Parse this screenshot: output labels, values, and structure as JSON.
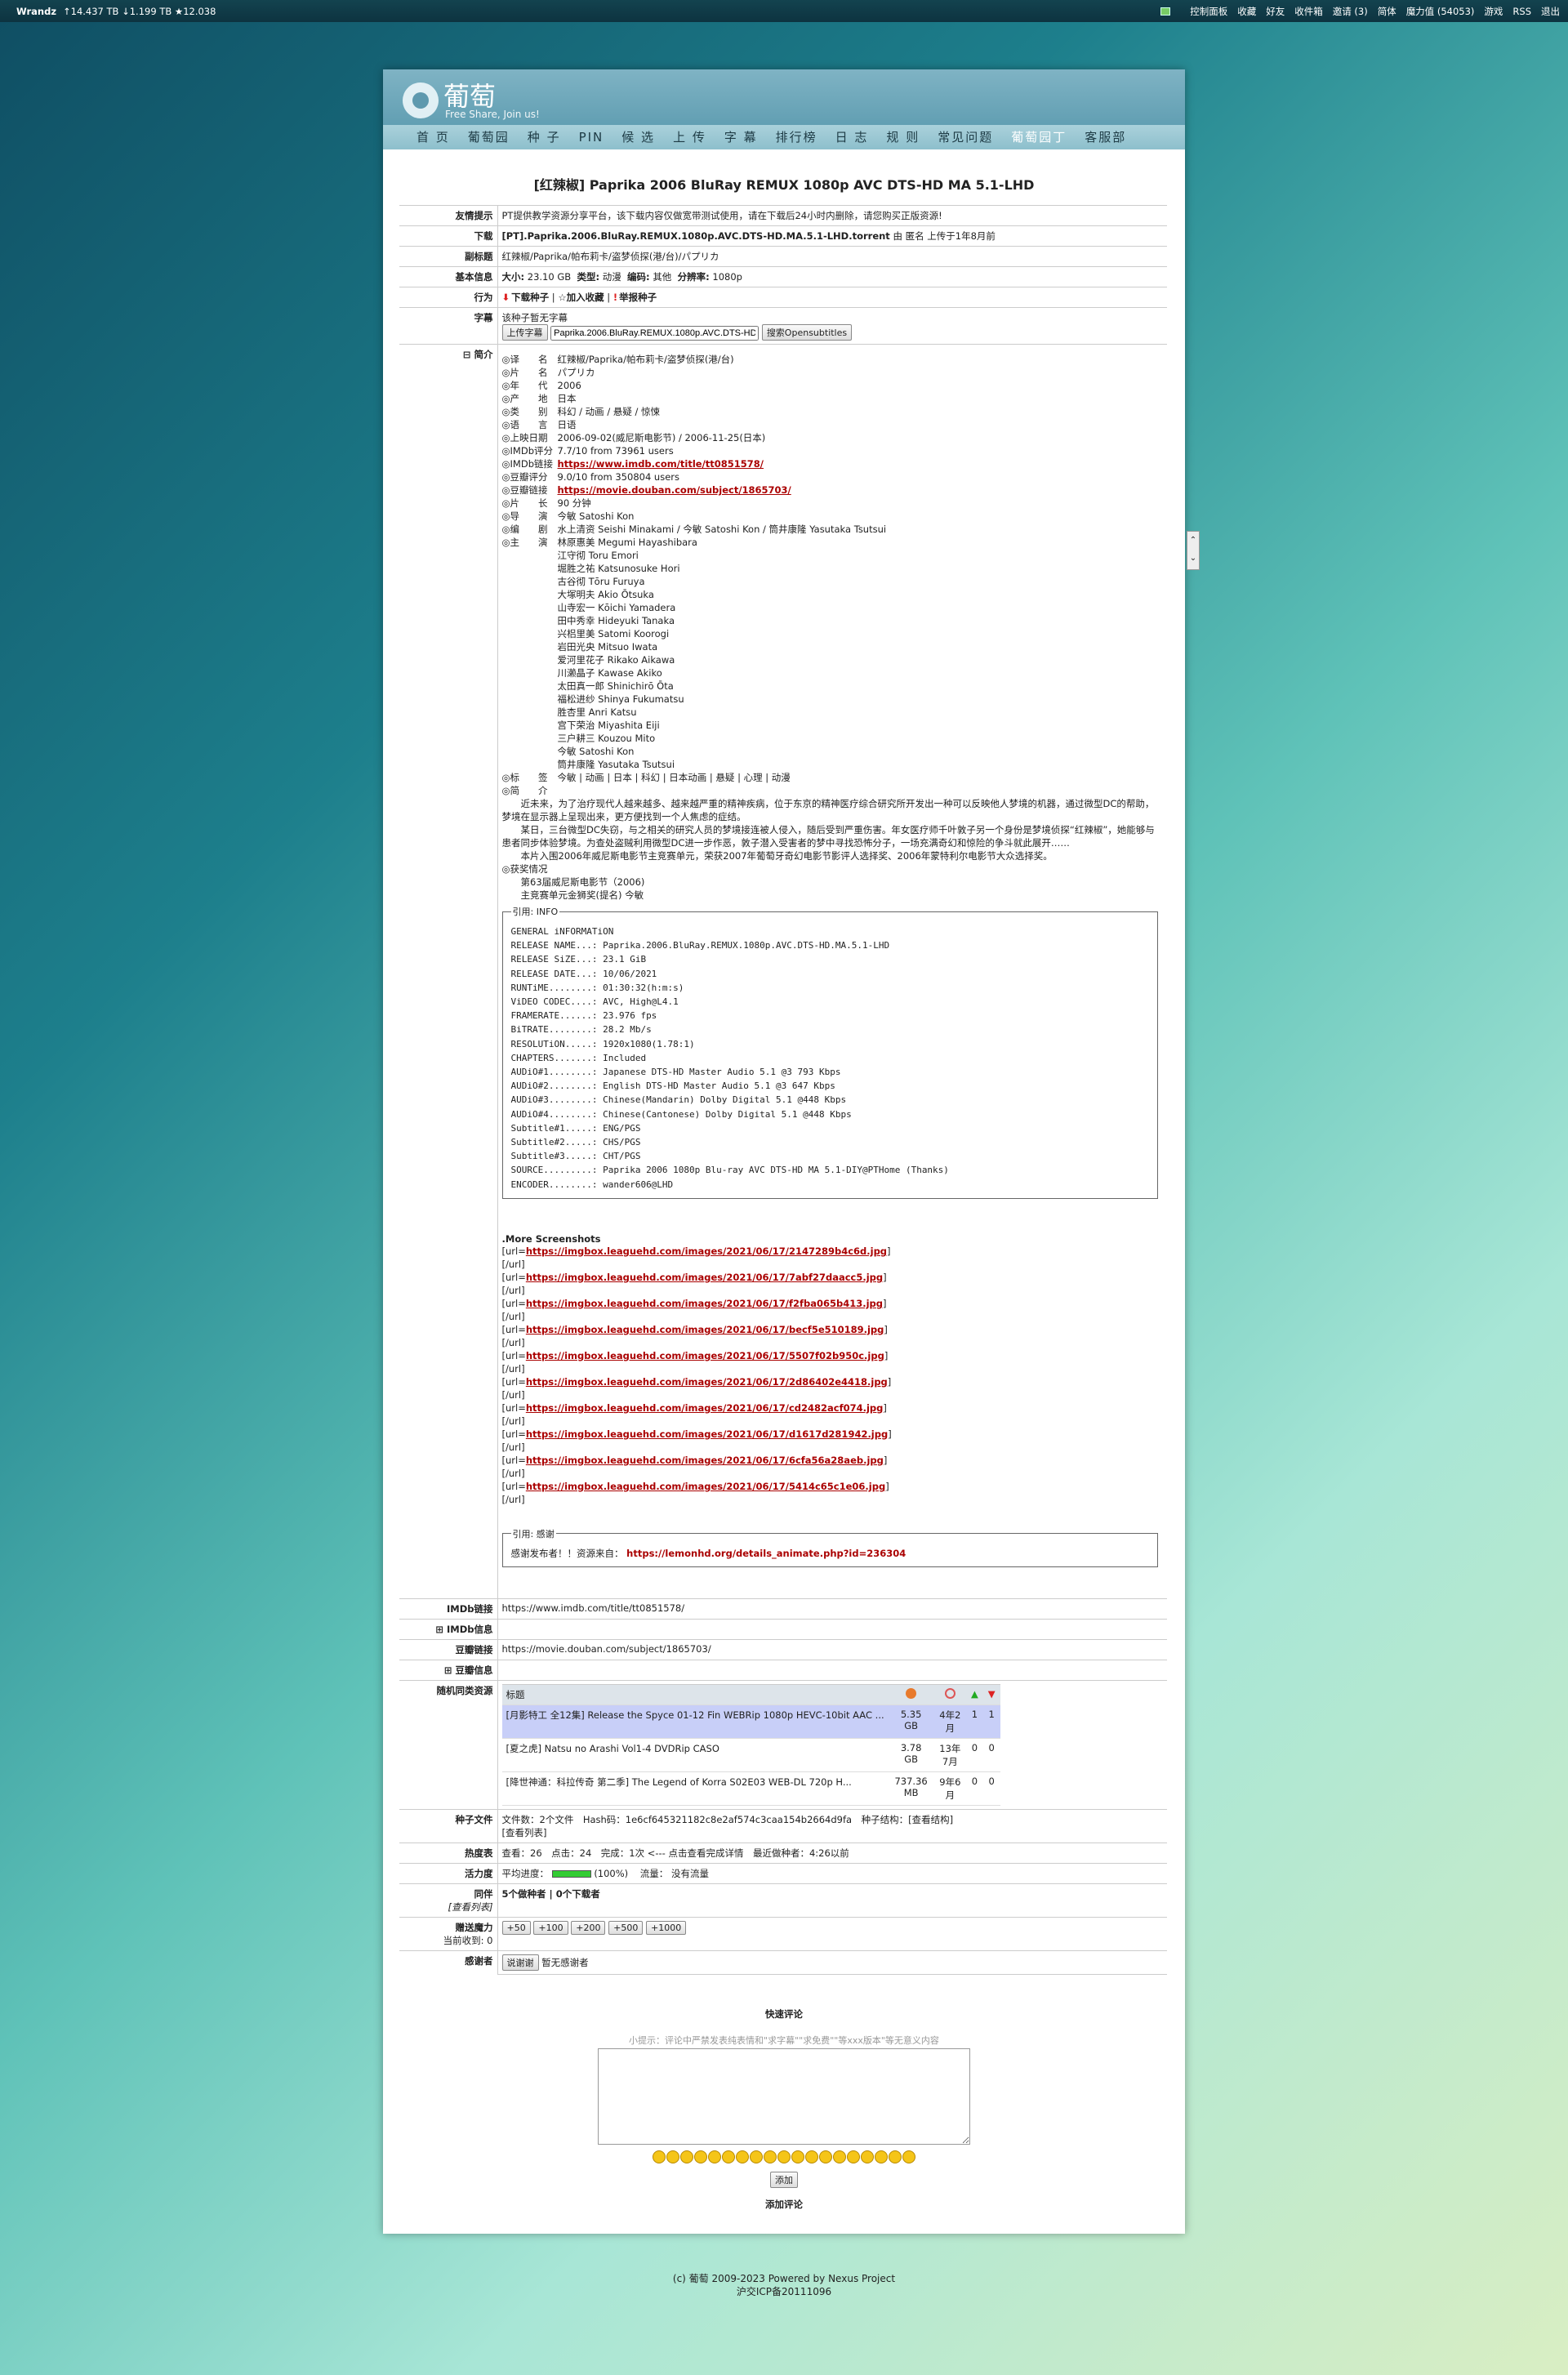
{
  "topbar": {
    "brand": "Wrandz",
    "stats": "↑14.437 TB ↓1.199 TB ★12.038",
    "links": [
      "控制面板",
      "收藏",
      "好友",
      "收件箱",
      "邀请 (3)",
      "简体",
      "魔力值 (54053)",
      "游戏",
      "RSS",
      "退出"
    ]
  },
  "site": {
    "name": "葡萄",
    "slogan": "Free Share, Join us!"
  },
  "nav": [
    "首 页",
    "葡萄园",
    "种 子",
    "PIN",
    "候 选",
    "上 传",
    "字 幕",
    "排行榜",
    "日 志",
    "规 则",
    "常见问题",
    "葡萄园丁",
    "客服部"
  ],
  "page_title": "[红辣椒] Paprika 2006 BluRay REMUX 1080p AVC DTS-HD MA 5.1-LHD",
  "rows": {
    "notice": {
      "label": "友情提示",
      "value": "PT提供教学资源分享平台，该下载内容仅做宽带测试使用，请在下载后24小时内删除，请您购买正版资源!"
    },
    "download": {
      "label": "下载",
      "file": "[PT].Paprika.2006.BluRay.REMUX.1080p.AVC.DTS-HD.MA.5.1-LHD.torrent",
      "by": "由 匿名 上传于1年8月前"
    },
    "subtitle": {
      "label": "副标题",
      "value": "红辣椒/Paprika/帕布莉卡/盗梦侦探(港/台)/パプリカ"
    },
    "basic": {
      "label": "基本信息",
      "size_label": "大小:",
      "size": "23.10 GB",
      "type_label": "类型:",
      "type": "动漫",
      "codec_label": "编码:",
      "codec": "其他",
      "res_label": "分辨率:",
      "res": "1080p"
    },
    "action": {
      "label": "行为",
      "download": "下载种子",
      "bookmark": "加入收藏",
      "report": "举报种子"
    },
    "subs": {
      "label": "字幕",
      "none": "该种子暂无字幕",
      "upload_btn": "上传字幕",
      "search_value": "Paprika.2006.BluRay.REMUX.1080p.AVC.DTS-HD",
      "search_btn": "搜索Opensubtitles"
    },
    "intro": {
      "label": "简介"
    }
  },
  "desc": [
    {
      "k": "◎译　　名",
      "v": "红辣椒/Paprika/帕布莉卡/盗梦侦探(港/台)"
    },
    {
      "k": "◎片　　名",
      "v": "パプリカ"
    },
    {
      "k": "◎年　　代",
      "v": "2006"
    },
    {
      "k": "◎产　　地",
      "v": "日本"
    },
    {
      "k": "◎类　　别",
      "v": "科幻 / 动画 / 悬疑 / 惊悚"
    },
    {
      "k": "◎语　　言",
      "v": "日语"
    },
    {
      "k": "◎上映日期",
      "v": "2006-09-02(威尼斯电影节) / 2006-11-25(日本)"
    },
    {
      "k": "◎IMDb评分",
      "v": "7.7/10 from 73961 users"
    },
    {
      "k": "◎IMDb链接",
      "v": "https://www.imdb.com/title/tt0851578/",
      "link": true
    },
    {
      "k": "◎豆瓣评分",
      "v": "9.0/10 from 350804 users"
    },
    {
      "k": "◎豆瓣链接",
      "v": "https://movie.douban.com/subject/1865703/",
      "link": true
    },
    {
      "k": "◎片　　长",
      "v": "90 分钟"
    },
    {
      "k": "◎导　　演",
      "v": "今敏 Satoshi Kon"
    },
    {
      "k": "◎编　　剧",
      "v": "水上清资 Seishi Minakami / 今敏 Satoshi Kon / 筒井康隆 Yasutaka Tsutsui"
    },
    {
      "k": "◎主　　演",
      "v": "林原惠美 Megumi Hayashibara"
    }
  ],
  "cast": [
    "江守彻 Toru Emori",
    "堀胜之祐 Katsunosuke Hori",
    "古谷彻 Tōru Furuya",
    "大塚明夫 Akio Ōtsuka",
    "山寺宏一 Kōichi Yamadera",
    "田中秀幸 Hideyuki Tanaka",
    "兴梠里美 Satomi Koorogi",
    "岩田光央 Mitsuo Iwata",
    "爱河里花子 Rikako Aikawa",
    "川濑晶子 Kawase Akiko",
    "太田真一郎 Shinichirō Ōta",
    "福松进纱 Shinya Fukumatsu",
    "胜杏里 Anri Katsu",
    "宫下荣治 Miyashita Eiji",
    "三户耕三 Kouzou Mito",
    "今敏 Satoshi Kon",
    "筒井康隆 Yasutaka Tsutsui"
  ],
  "desc2": [
    {
      "k": "◎标　　签",
      "v": "今敏 | 动画 | 日本 | 科幻 | 日本动画 | 悬疑 | 心理 | 动漫"
    },
    {
      "k": "◎简　　介",
      "v": ""
    }
  ],
  "synopsis": [
    "　　近未来，为了治疗现代人越来越多、越来越严重的精神疾病，位于东京的精神医疗综合研究所开发出一种可以反映他人梦境的机器，通过微型DC的帮助，梦境在显示器上呈现出来，更方便找到一个人焦虑的症结。",
    "　　某日，三台微型DC失窃，与之相关的研究人员的梦境接连被人侵入，随后受到严重伤害。年女医疗师千叶敦子另一个身份是梦境侦探“红辣椒”，她能够与患者同步体验梦境。为查处盗贼利用微型DC进一步作恶，敦子潜入受害者的梦中寻找恐怖分子，一场充满奇幻和惊险的争斗就此展开……",
    "　　本片入围2006年威尼斯电影节主竞赛单元，荣获2007年葡萄牙奇幻电影节影评人选择奖、2006年蒙特利尔电影节大众选择奖。"
  ],
  "awards": {
    "k": "◎获奖情况",
    "lines": [
      "　　第63届威尼斯电影节（2006)",
      "　　主竞赛单元金狮奖(提名) 今敏"
    ]
  },
  "info_legend": "引用: INFO",
  "info_text": "GENERAL iNFORMATiON\nRELEASE NAME...: Paprika.2006.BluRay.REMUX.1080p.AVC.DTS-HD.MA.5.1-LHD\nRELEASE SiZE...: 23.1 GiB\nRELEASE DATE...: 10/06/2021\nRUNTiME........: 01:30:32(h:m:s)\nViDEO CODEC....: AVC, High@L4.1\nFRAMERATE......: 23.976 fps\nBiTRATE........: 28.2 Mb/s\nRESOLUTiON.....: 1920x1080(1.78:1)\nCHAPTERS.......: Included\nAUDiO#1........: Japanese DTS-HD Master Audio 5.1 @3 793 Kbps\nAUDiO#2........: English DTS-HD Master Audio 5.1 @3 647 Kbps\nAUDiO#3........: Chinese(Mandarin) Dolby Digital 5.1 @448 Kbps\nAUDiO#4........: Chinese(Cantonese) Dolby Digital 5.1 @448 Kbps\nSubtitle#1.....: ENG/PGS\nSubtitle#2.....: CHS/PGS\nSubtitle#3.....: CHT/PGS\nSOURCE.........: Paprika 2006 1080p Blu-ray AVC DTS-HD MA 5.1-DIY@PTHome (Thanks)\nENCODER........: wander606@LHD",
  "screens_title": ".More Screenshots",
  "screens": [
    "https://imgbox.leaguehd.com/images/2021/06/17/2147289b4c6d.jpg",
    "https://imgbox.leaguehd.com/images/2021/06/17/7abf27daacc5.jpg",
    "https://imgbox.leaguehd.com/images/2021/06/17/f2fba065b413.jpg",
    "https://imgbox.leaguehd.com/images/2021/06/17/becf5e510189.jpg",
    "https://imgbox.leaguehd.com/images/2021/06/17/5507f02b950c.jpg",
    "https://imgbox.leaguehd.com/images/2021/06/17/2d86402e4418.jpg",
    "https://imgbox.leaguehd.com/images/2021/06/17/cd2482acf074.jpg",
    "https://imgbox.leaguehd.com/images/2021/06/17/d1617d281942.jpg",
    "https://imgbox.leaguehd.com/images/2021/06/17/6cfa56a28aeb.jpg",
    "https://imgbox.leaguehd.com/images/2021/06/17/5414c65c1e06.jpg"
  ],
  "thanks_legend": "引用: 感谢",
  "thanks_text": "感谢发布者！！资源来自：",
  "thanks_link": "https://lemonhd.org/details_animate.php?id=236304",
  "imdb": {
    "label": "IMDb链接",
    "value": "https://www.imdb.com/title/tt0851578/"
  },
  "imdb_info": {
    "label": "IMDb信息"
  },
  "douban": {
    "label": "豆瓣链接",
    "value": "https://movie.douban.com/subject/1865703/"
  },
  "douban_info": {
    "label": "豆瓣信息"
  },
  "related": {
    "label": "随机同类资源",
    "header": "标题",
    "rows": [
      {
        "title": "[月影特工 全12集] Release the Spyce 01-12 Fin WEBRip 1080p HEVC-10bit AAC ...",
        "size": "5.35 GB",
        "age": "4年2月",
        "seed": "1",
        "leech": "1"
      },
      {
        "title": "[夏之虎] Natsu no Arashi Vol1-4 DVDRip CASO",
        "size": "3.78 GB",
        "age": "13年7月",
        "seed": "0",
        "leech": "0"
      },
      {
        "title": "[降世神通：科拉传奇 第二季] The Legend of Korra S02E03 WEB-DL 720p H...",
        "size": "737.36 MB",
        "age": "9年6月",
        "seed": "0",
        "leech": "0"
      }
    ]
  },
  "torrent_file": {
    "label": "种子文件",
    "text": "文件数：2个文件　Hash码：1e6cf645321182c8e2af574c3caa154b2664d9fa　种子结构：[查看结构]",
    "sub": "[查看列表]"
  },
  "heat": {
    "label": "热度表",
    "text": "查看：26　点击：24　完成：1次 <--- 点击查看完成详情　最近做种者：4:26以前"
  },
  "vitality": {
    "label": "活力度",
    "avg": "平均进度：",
    "pct": "(100%)",
    "traffic": "流量： 没有流量",
    "progress": 1.0
  },
  "peers": {
    "label": "同伴",
    "sub": "[查看列表]",
    "text": "5个做种者 | 0个下载者"
  },
  "bonus": {
    "label": "赠送魔力",
    "sub": "当前收到: 0",
    "buttons": [
      "+50",
      "+100",
      "+200",
      "+500",
      "+1000"
    ]
  },
  "thanks": {
    "label": "感谢者",
    "btn": "说谢谢",
    "text": "暂无感谢者"
  },
  "comment": {
    "title": "快速评论",
    "tip": "小提示：评论中严禁发表纯表情和\"求字幕\"\"求免费\"\"等xxx版本\"等无意义内容",
    "add_btn": "添加",
    "add_link": "添加评论"
  },
  "footer": {
    "line1": "(c) 葡萄 2009-2023 Powered by Nexus Project",
    "line2": "沪交ICP备20111096"
  }
}
